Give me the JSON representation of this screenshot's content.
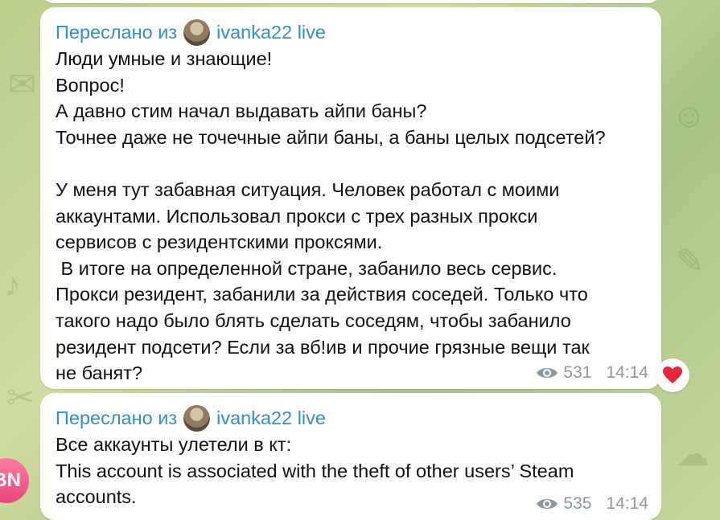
{
  "messages": [
    {
      "forwarded_prefix": "Переслано из",
      "channel_name": "ivanka22 live",
      "text": "Люди умные и знающие!\nВопрос!\nА давно стим начал выдавать айпи баны?\nТочнее даже не точечные айпи баны, а баны целых подсетей?\n\nУ меня тут забавная ситуация. Человек работал с моими\nаккаунтами. Использовал прокси с трех разных прокси\nсервисов с резидентскими проксями.\n В итоге на определенной стране, забанило весь сервис.\nПрокси резидент, забанили за действия соседей. Только что\nтакого надо было блять сделать соседям, чтобы забанило\nрезидент подсети? Если за вб!ив и прочие грязные вещи так\nне банят?",
      "views": "531",
      "time": "14:14",
      "reaction": "heart"
    },
    {
      "forwarded_prefix": "Переслано из",
      "channel_name": "ivanka22 live",
      "text": "Все аккаунты улетели в кт:\nThis account is associated with the theft of other users’ Steam\naccounts.",
      "views": "535",
      "time": "14:14"
    }
  ],
  "user_avatar": {
    "initials": "BN",
    "color": "#e8457c"
  },
  "colors": {
    "link": "#2f8fcf",
    "meta": "#8d98a3",
    "heart": "#e8253a"
  }
}
